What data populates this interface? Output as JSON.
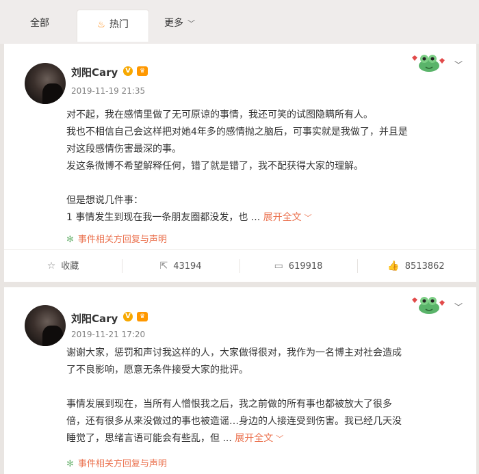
{
  "tabs": {
    "all": "全部",
    "hot": "热门",
    "more": "更多"
  },
  "posts": [
    {
      "author": "刘阳Cary",
      "time": "2019-11-19 21:35",
      "text_lines": [
        "对不起，我在感情里做了无可原谅的事情，我还可笑的试图隐瞒所有人。",
        "我也不相信自己会这样把对她4年多的感情抛之脑后，可事实就是我做了，并且是",
        "对这段感情伤害最深的事。",
        "发这条微博不希望解释任何，错了就是错了，我不配获得大家的理解。",
        "",
        "但是想说几件事：",
        "1 事情发生到现在我一条朋友圈都没发，也 ..."
      ],
      "expand": "展开全文",
      "statement": "事件相关方回复与声明",
      "actions": {
        "favorite": "收藏",
        "repost": "43194",
        "comment": "619918",
        "like": "8513862"
      }
    },
    {
      "author": "刘阳Cary",
      "time": "2019-11-21 17:20",
      "text_lines": [
        "谢谢大家，惩罚和声讨我这样的人，大家做得很对，我作为一名博主对社会造成",
        "了不良影响，愿意无条件接受大家的批评。",
        "",
        "事情发展到现在，当所有人憎恨我之后，我之前做的所有事也都被放大了很多",
        "倍，还有很多从来没做过的事也被造谣…身边的人接连受到伤害。我已经几天没",
        "睡觉了，思绪言语可能会有些乱，但 ..."
      ],
      "expand": "展开全文",
      "statement": "事件相关方回复与声明"
    }
  ],
  "badges": {
    "verified": "V",
    "vip": "♛"
  },
  "colors": {
    "accent": "#eb7350",
    "brand": "#ff8200",
    "statement_icon": "#77b97c"
  }
}
